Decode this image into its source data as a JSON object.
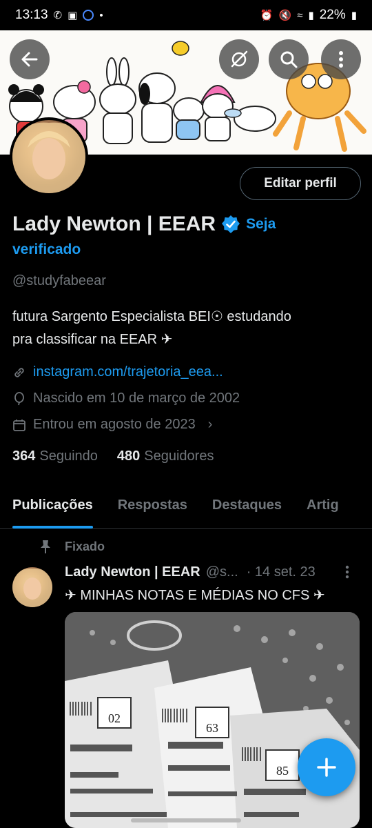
{
  "status_bar": {
    "time": "13:13",
    "battery": "22%"
  },
  "profile": {
    "display_name": "Lady Newton | EEAR",
    "verify_cta_line1": "Seja",
    "verify_cta_line2": "verificado",
    "handle": "@studyfabeear",
    "bio_line1": "futura Sargento Especialista BEI☉ estudando",
    "bio_line2": "pra classificar na EEAR ✈",
    "link": "instagram.com/trajetoria_eea...",
    "birthday": "Nascido em 10 de março de 2002",
    "joined": "Entrou em agosto de 2023",
    "following_count": "364",
    "following_label": "Seguindo",
    "followers_count": "480",
    "followers_label": "Seguidores",
    "edit_button": "Editar perfil"
  },
  "tabs": [
    "Publicações",
    "Respostas",
    "Destaques",
    "Artig"
  ],
  "pinned": {
    "label": "Fixado",
    "author": "Lady Newton | EEAR",
    "handle": "@s...",
    "date": "· 14 set. 23",
    "text": "✈ MINHAS NOTAS E MÉDIAS NO CFS ✈"
  },
  "colors": {
    "accent": "#1d9bf0",
    "background": "#000000",
    "muted": "#71767b"
  }
}
